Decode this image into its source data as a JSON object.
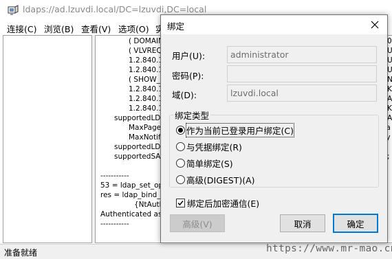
{
  "window": {
    "title": "ldaps://ad.lzuvdi.local/DC=lzuvdi,DC=local"
  },
  "menu": {
    "items": [
      "连接(C)",
      "浏览(B)",
      "查看(V)",
      "选项(O)",
      "实"
    ]
  },
  "log": {
    "lines": [
      "( DOMAIN",
      "( VLVREQ",
      "1.2.840.1",
      "1.2.840.1",
      "( SHOW_",
      "1.2.840.1",
      "1.2.840.1",
      "1.2.840.1",
      "supportedLDA",
      "MaxPageS",
      "MaxNotific",
      "supportedLDA",
      "supportedSAS",
      "-----------",
      "53 = ldap_set_opt",
      "res = ldap_bind_s",
      "{NtAuth",
      "Authenticated as:",
      "-----------"
    ],
    "right_edge_fragments": [
      "0.",
      "U",
      "U",
      "U",
      "N",
      "K",
      "A",
      "K",
      "A",
      "ra",
      "ry",
      ";",
      ""
    ]
  },
  "status": {
    "text": "准备就绪"
  },
  "watermark": "https://www.mr-mao.cn",
  "dialog": {
    "title": "绑定",
    "fields": {
      "user_label": "用户(U):",
      "user_value": "administrator",
      "password_label": "密码(P):",
      "password_value": "",
      "domain_label": "域(D):",
      "domain_value": "lzuvdi.local"
    },
    "bind_type_group": "绑定类型",
    "bind_options": [
      "作为当前已登录用户绑定(C)",
      "与凭据绑定(R)",
      "简单绑定(S)",
      "高级(DIGEST)(A)"
    ],
    "selected_option_index": 0,
    "encrypt_label": "绑定后加密通信(E)",
    "encrypt_checked": true,
    "buttons": {
      "advanced": "高级(V)",
      "cancel": "取消",
      "ok": "确定"
    }
  }
}
